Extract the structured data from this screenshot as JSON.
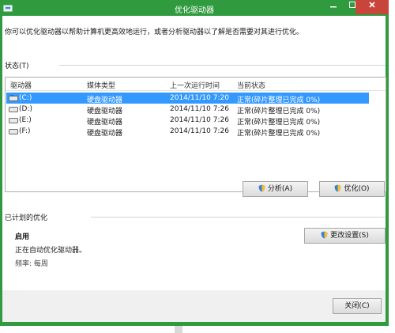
{
  "window": {
    "title": "优化驱动器"
  },
  "description": "你可以优化驱动器以帮助计算机更高效地运行，或者分析驱动器以了解是否需要对其进行优化。",
  "status_section": {
    "label": "状态(T)",
    "columns": [
      "驱动器",
      "媒体类型",
      "上一次运行时间",
      "当前状态"
    ],
    "rows": [
      {
        "drive": "(C:)",
        "media": "硬盘驱动器",
        "last_run": "2014/11/10 7:20",
        "status": "正常(碎片整理已完成 0%)",
        "selected": true
      },
      {
        "drive": "(D:)",
        "media": "硬盘驱动器",
        "last_run": "2014/11/10 7:26",
        "status": "正常(碎片整理已完成 0%)",
        "selected": false
      },
      {
        "drive": "(E:)",
        "media": "硬盘驱动器",
        "last_run": "2014/11/10 7:26",
        "status": "正常(碎片整理已完成 0%)",
        "selected": false
      },
      {
        "drive": "(F:)",
        "media": "硬盘驱动器",
        "last_run": "2014/11/10 7:26",
        "status": "正常(碎片整理已完成 0%)",
        "selected": false
      }
    ]
  },
  "buttons": {
    "analyze": "分析(A)",
    "optimize": "优化(O)",
    "change_settings": "更改设置(S)",
    "close": "关闭(C)"
  },
  "scheduled_section": {
    "label": "已计划的优化",
    "state": "启用",
    "line1": "正在自动优化驱动器。",
    "frequency": "频率: 每周"
  },
  "colors": {
    "titlebar": "#2f9a3e",
    "selection": "#3399ff",
    "close_button": "#c7453a"
  }
}
